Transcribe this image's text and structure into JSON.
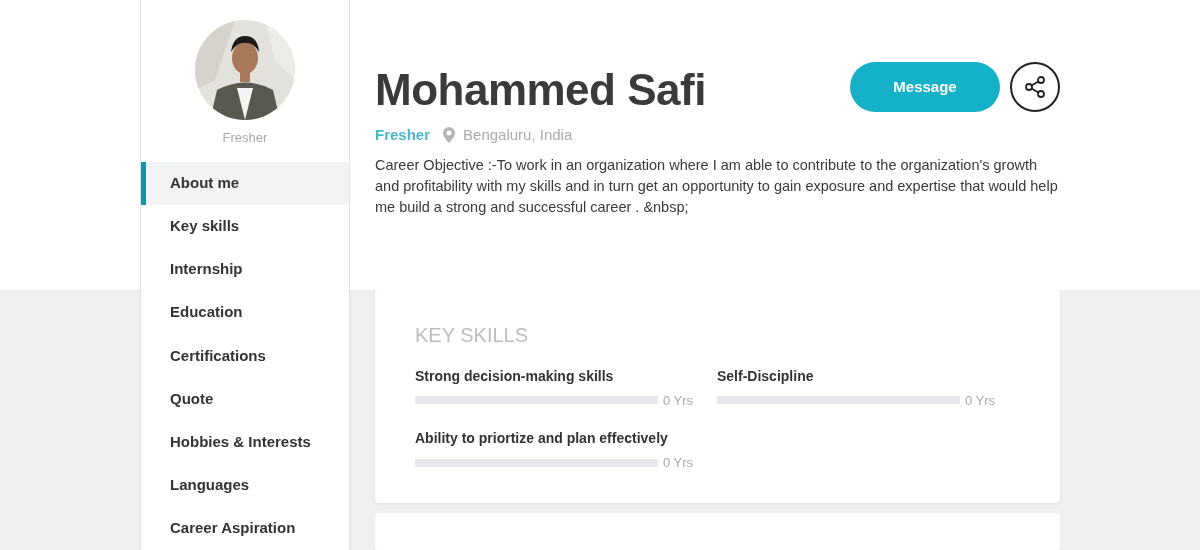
{
  "sidebar": {
    "status": "Fresher",
    "items": [
      {
        "label": "About me",
        "selected": true
      },
      {
        "label": "Key skills",
        "selected": false
      },
      {
        "label": "Internship",
        "selected": false
      },
      {
        "label": "Education",
        "selected": false
      },
      {
        "label": "Certifications",
        "selected": false
      },
      {
        "label": "Quote",
        "selected": false
      },
      {
        "label": "Hobbies & Interests",
        "selected": false
      },
      {
        "label": "Languages",
        "selected": false
      },
      {
        "label": "Career Aspiration",
        "selected": false
      }
    ]
  },
  "profile": {
    "name": "Mohammed Safi",
    "status": "Fresher",
    "location": "Bengaluru, India",
    "objective": "Career Objective :-To work in an organization where I am able to contribute to the organization's growth and profitability with my skills and in turn get an opportunity to gain exposure and expertise that would help me build a strong and successful career . &nbsp;",
    "message_button": "Message"
  },
  "key_skills": {
    "title": "KEY SKILLS",
    "skills": [
      {
        "name": "Strong decision-making skills",
        "level": 0,
        "reading": "0 Yrs"
      },
      {
        "name": "Self-Discipline",
        "level": 0,
        "reading": "0 Yrs"
      },
      {
        "name": "Ability to priortize and plan effectively",
        "level": 0,
        "reading": "0 Yrs"
      }
    ]
  }
}
